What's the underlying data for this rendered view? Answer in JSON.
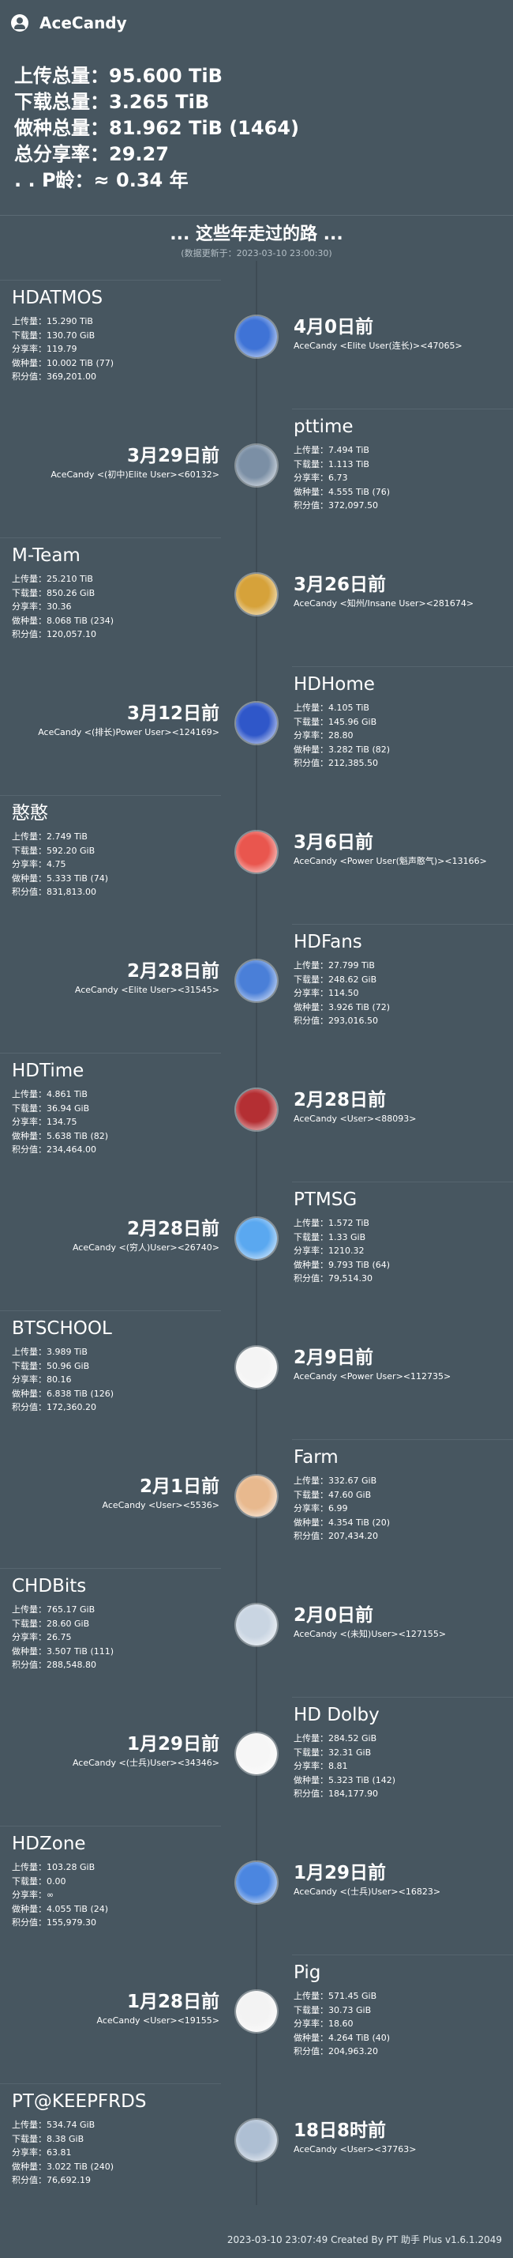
{
  "header": {
    "username": "AceCandy",
    "stats": [
      {
        "label": "上传总量：",
        "value": "95.600 TiB"
      },
      {
        "label": "下载总量：",
        "value": "3.265 TiB"
      },
      {
        "label": "做种总量：",
        "value": "81.962 TiB (1464)"
      },
      {
        "label": "总分享率：",
        "value": "29.27"
      },
      {
        "label": ". .   P龄：",
        "value": "≈ 0.34 年"
      }
    ]
  },
  "journey": {
    "title": "... 这些年走过的路 ...",
    "subtitle": "(数据更新于：2023-03-10 23:00:30)"
  },
  "sites": [
    {
      "name": "HDATMOS",
      "up": "上传量：15.290 TiB",
      "down": "下载量：130.70 GiB",
      "ratio": "分享率：119.79",
      "seed": "做种量：10.002 TiB (77)",
      "bonus": "积分值：369,201.00",
      "date": "4月0日前",
      "user": "AceCandy  <Elite User(连长)><47065>",
      "avatar": "#3f73d6"
    },
    {
      "name": "pttime",
      "up": "上传量：7.494 TiB",
      "down": "下载量：1.113 TiB",
      "ratio": "分享率：6.73",
      "seed": "做种量：4.555 TiB (76)",
      "bonus": "积分值：372,097.50",
      "date": "3月29日前",
      "user": "AceCandy  <(初中)Elite User><60132>",
      "avatar": "#7b8fa5"
    },
    {
      "name": "M-Team",
      "up": "上传量：25.210 TiB",
      "down": "下载量：850.26 GiB",
      "ratio": "分享率：30.36",
      "seed": "做种量：8.068 TiB (234)",
      "bonus": "积分值：120,057.10",
      "date": "3月26日前",
      "user": "AceCandy  <知州/Insane User><281674>",
      "avatar": "#d6a23a"
    },
    {
      "name": "HDHome",
      "up": "上传量：4.105 TiB",
      "down": "下载量：145.96 GiB",
      "ratio": "分享率：28.80",
      "seed": "做种量：3.282 TiB (82)",
      "bonus": "积分值：212,385.50",
      "date": "3月12日前",
      "user": "AceCandy  <(排长)Power User><124169>",
      "avatar": "#2f57c9"
    },
    {
      "name": "憨憨",
      "up": "上传量：2.749 TiB",
      "down": "下载量：592.20 GiB",
      "ratio": "分享率：4.75",
      "seed": "做种量：5.333 TiB (74)",
      "bonus": "积分值：831,813.00",
      "date": "3月6日前",
      "user": "AceCandy  <Power User(魁声憨气)><13166>",
      "avatar": "#e9564e"
    },
    {
      "name": "HDFans",
      "up": "上传量：27.799 TiB",
      "down": "下载量：248.62 GiB",
      "ratio": "分享率：114.50",
      "seed": "做种量：3.926 TiB (72)",
      "bonus": "积分值：293,016.50",
      "date": "2月28日前",
      "user": "AceCandy  <Elite User><31545>",
      "avatar": "#4a7fd8"
    },
    {
      "name": "HDTime",
      "up": "上传量：4.861 TiB",
      "down": "下载量：36.94 GiB",
      "ratio": "分享率：134.75",
      "seed": "做种量：5.638 TiB (82)",
      "bonus": "积分值：234,464.00",
      "date": "2月28日前",
      "user": "AceCandy  <User><88093>",
      "avatar": "#b42f33"
    },
    {
      "name": "PTMSG",
      "up": "上传量：1.572 TiB",
      "down": "下载量：1.33 GiB",
      "ratio": "分享率：1210.32",
      "seed": "做种量：9.793 TiB (64)",
      "bonus": "积分值：79,514.30",
      "date": "2月28日前",
      "user": "AceCandy  <(穷人)User><26740>",
      "avatar": "#5aa8f0"
    },
    {
      "name": "BTSCHOOL",
      "up": "上传量：3.989 TiB",
      "down": "下载量：50.96 GiB",
      "ratio": "分享率：80.16",
      "seed": "做种量：6.838 TiB (126)",
      "bonus": "积分值：172,360.20",
      "date": "2月9日前",
      "user": "AceCandy  <Power User><112735>",
      "avatar": "#f4f4f4"
    },
    {
      "name": "Farm",
      "up": "上传量：332.67 GiB",
      "down": "下载量：47.60 GiB",
      "ratio": "分享率：6.99",
      "seed": "做种量：4.354 TiB (20)",
      "bonus": "积分值：207,434.20",
      "date": "2月1日前",
      "user": "AceCandy  <User><5536>",
      "avatar": "#e8b98e"
    },
    {
      "name": "CHDBits",
      "up": "上传量：765.17 GiB",
      "down": "下载量：28.60 GiB",
      "ratio": "分享率：26.75",
      "seed": "做种量：3.507 TiB (111)",
      "bonus": "积分值：288,548.80",
      "date": "2月0日前",
      "user": "AceCandy  <(未知)User><127155>",
      "avatar": "#c9d5e2"
    },
    {
      "name": "HD Dolby",
      "up": "上传量：284.52 GiB",
      "down": "下载量：32.31 GiB",
      "ratio": "分享率：8.81",
      "seed": "做种量：5.323 TiB (142)",
      "bonus": "积分值：184,177.90",
      "date": "1月29日前",
      "user": "AceCandy  <(士兵)User><34346>",
      "avatar": "#f6f6f6"
    },
    {
      "name": "HDZone",
      "up": "上传量：103.28 GiB",
      "down": "下载量：0.00",
      "ratio": "分享率：∞",
      "seed": "做种量：4.055 TiB (24)",
      "bonus": "积分值：155,979.30",
      "date": "1月29日前",
      "user": "AceCandy  <(士兵)User><16823>",
      "avatar": "#4b86e0"
    },
    {
      "name": "Pig",
      "up": "上传量：571.45 GiB",
      "down": "下载量：30.73 GiB",
      "ratio": "分享率：18.60",
      "seed": "做种量：4.264 TiB (40)",
      "bonus": "积分值：204,963.20",
      "date": "1月28日前",
      "user": "AceCandy  <User><19155>",
      "avatar": "#f3f3f3"
    },
    {
      "name": "PT@KEEPFRDS",
      "up": "上传量：534.74 GiB",
      "down": "下载量：8.38 GiB",
      "ratio": "分享率：63.81",
      "seed": "做种量：3.022 TiB (240)",
      "bonus": "积分值：76,692.19",
      "date": "18日8时前",
      "user": "AceCandy  <User><37763>",
      "avatar": "#aebfd3"
    }
  ],
  "footer": "2023-03-10 23:07:49 Created By PT 助手 Plus v1.6.1.2049"
}
